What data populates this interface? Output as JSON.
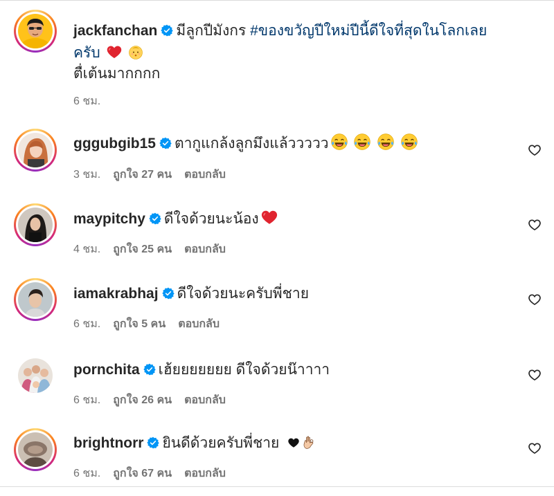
{
  "caption": {
    "username": "jackfanchan",
    "text": "มีลูกปีมังกร",
    "hashtag": "#ของขวัญปีใหม่ปีนี้ดีใจที่สุดในโลกเลย",
    "text2": "ครับ",
    "line2": "ตื่เต้นมากกกก",
    "time": "6 ชม."
  },
  "comments": [
    {
      "username": "gggubgib15",
      "text": "ตากูแกล้งลูกมึงแล้ววววว",
      "time": "3 ชม.",
      "likes": "ถูกใจ 27 คน",
      "reply": "ตอบกลับ"
    },
    {
      "username": "maypitchy",
      "text": "ดีใจด้วยนะน้อง",
      "time": "4 ชม.",
      "likes": "ถูกใจ 25 คน",
      "reply": "ตอบกลับ"
    },
    {
      "username": "iamakrabhaj",
      "text": "ดีใจด้วยนะครับพี่ชาย",
      "time": "6 ชม.",
      "likes": "ถูกใจ 5 คน",
      "reply": "ตอบกลับ"
    },
    {
      "username": "pornchita",
      "text": "เฮ้ยยยยยยย ดีใจด้วยน๊าาาา",
      "time": "6 ชม.",
      "likes": "ถูกใจ 26 คน",
      "reply": "ตอบกลับ"
    },
    {
      "username": "brightnorr",
      "text": "ยินดีด้วยครับพี่ชาย",
      "time": "6 ชม.",
      "likes": "ถูกใจ 67 คน",
      "reply": "ตอบกลับ"
    }
  ],
  "icons": {
    "verified": "verified-badge-icon",
    "like": "heart-outline-icon"
  },
  "colors": {
    "verified": "#0095f6",
    "hashtag": "#00376b",
    "muted": "#737373"
  }
}
